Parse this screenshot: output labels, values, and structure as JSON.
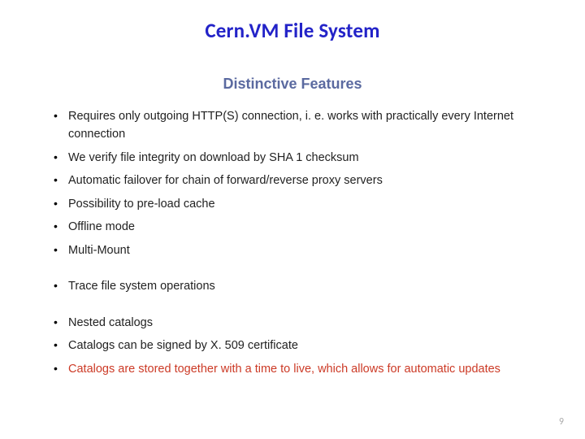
{
  "title": "Cern.VM File System",
  "subtitle": "Distinctive Features",
  "bullets": {
    "g1": {
      "i0": "Requires only outgoing HTTP(S) connection, i. e. works with practically every Internet connection",
      "i1": "We verify file integrity on download by SHA 1 checksum",
      "i2": "Automatic failover for chain of forward/reverse proxy servers",
      "i3": "Possibility to pre-load cache",
      "i4": "Offline mode",
      "i5": "Multi-Mount"
    },
    "g2": {
      "i0": "Trace file system operations"
    },
    "g3": {
      "i0": "Nested catalogs",
      "i1": "Catalogs can be signed by X. 509 certificate",
      "i2": "Catalogs are stored together with a time to live, which allows for automatic updates"
    }
  },
  "page_number": "9"
}
